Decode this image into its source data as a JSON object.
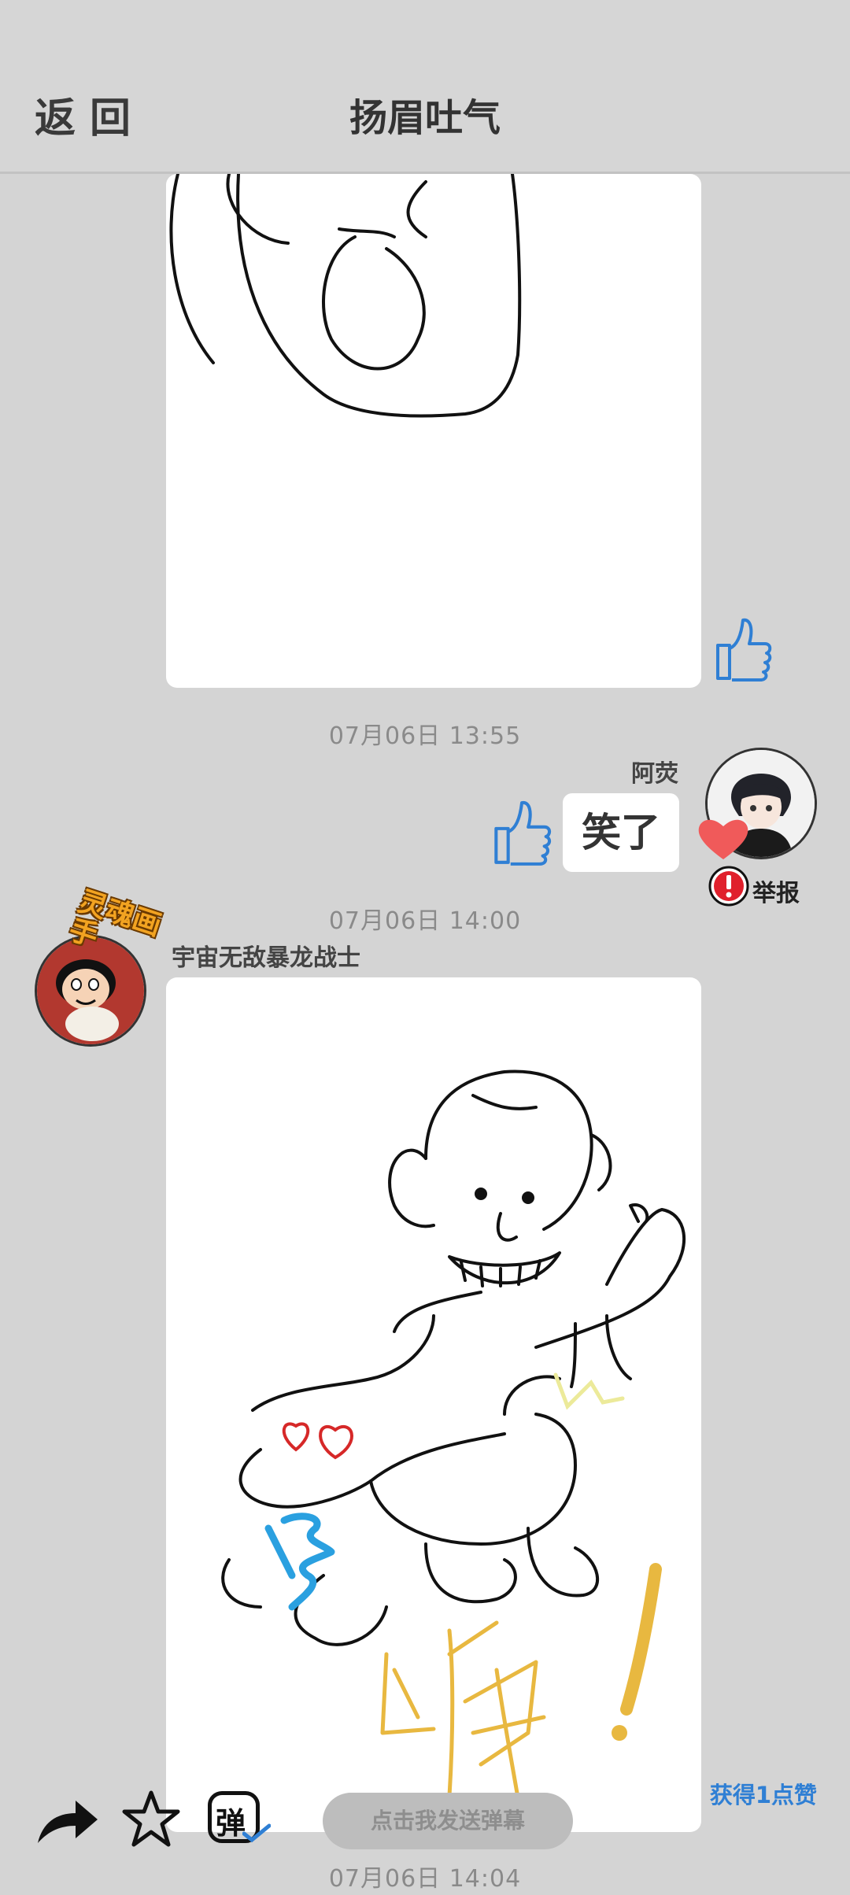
{
  "header": {
    "back_label": "返回",
    "title": "扬眉吐气"
  },
  "messages": [
    {
      "time": "07月06日 13:55"
    },
    {
      "time": "07月06日 14:00",
      "sender": "阿荧",
      "text": "笑了",
      "report_label": "举报"
    },
    {
      "time": "07月06日 14:04",
      "sender": "宇宙无敌暴龙战士",
      "avatar_badge": "灵魂画手",
      "drawing_text": "哼!"
    }
  ],
  "toolbar": {
    "danmaku_placeholder": "点击我发送弹幕",
    "danmaku_icon_char": "弹",
    "earn_likes_label": "获得1点赞"
  },
  "colors": {
    "like_blue": "#2f7fd4",
    "heart_red": "#f05a5a",
    "report_red": "#e0202c"
  },
  "icons": [
    "share-icon",
    "star-icon",
    "danmaku-icon",
    "thumbs-up-icon",
    "heart-icon",
    "alert-icon"
  ]
}
